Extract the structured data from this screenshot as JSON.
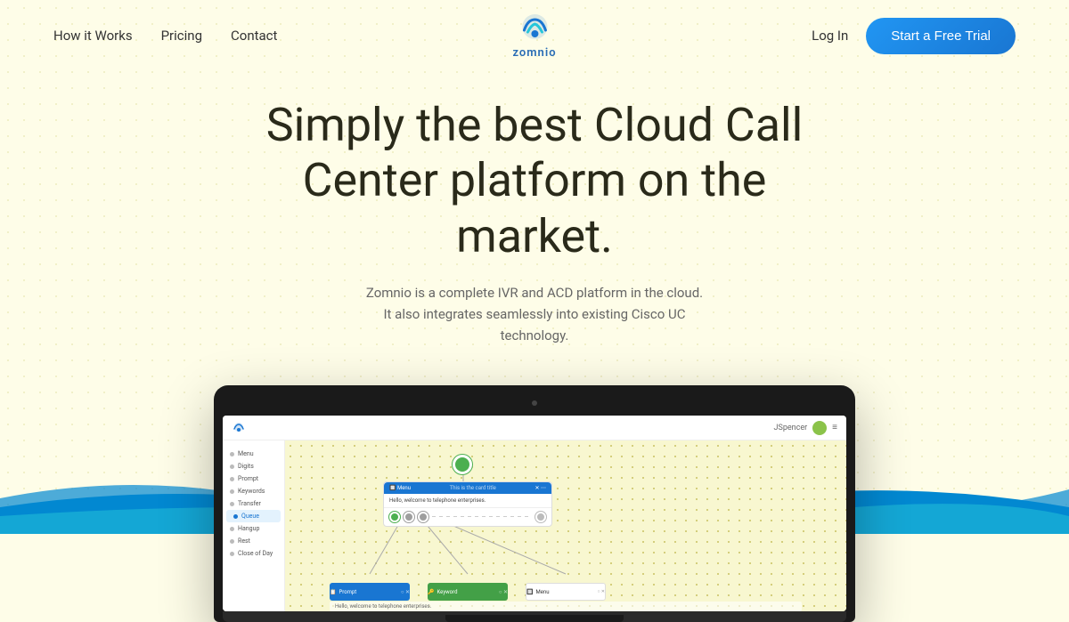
{
  "nav": {
    "links": [
      {
        "label": "How it Works",
        "id": "how-it-works"
      },
      {
        "label": "Pricing",
        "id": "pricing"
      },
      {
        "label": "Contact",
        "id": "contact"
      }
    ],
    "logo_text": "zomnio",
    "login_label": "Log In",
    "cta_label": "Start a Free Trial"
  },
  "hero": {
    "title": "Simply the best Cloud Call Center platform on the market.",
    "subtitle": "Zomnio is a complete IVR and ACD platform in the cloud. It also integrates seamlessly into existing Cisco UC technology."
  },
  "app_ui": {
    "user": "JSpencer",
    "sidebar_items": [
      {
        "label": "Menu"
      },
      {
        "label": "Digits"
      },
      {
        "label": "Prompt"
      },
      {
        "label": "Keywords"
      },
      {
        "label": "Transfer"
      },
      {
        "label": "Queue",
        "active": true
      },
      {
        "label": "Hangup"
      },
      {
        "label": "Rest"
      },
      {
        "label": "Close of Day"
      }
    ],
    "canvas": {
      "menu_title": "Menu",
      "menu_subtitle": "This is the card title",
      "menu_body": "Hello, welcome to telephone enterprises.",
      "node_prompt": "Prompt",
      "node_keyword": "Keyword",
      "node_menu": "Menu"
    }
  },
  "waves": {
    "color1": "#0288d1",
    "color2": "#26c6da"
  }
}
